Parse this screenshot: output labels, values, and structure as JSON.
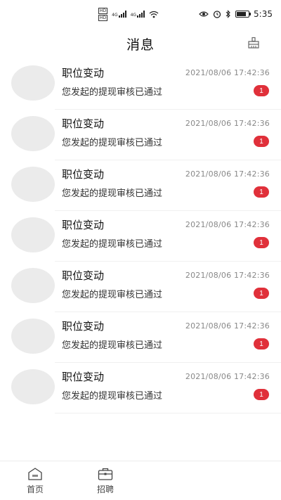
{
  "status_bar": {
    "sim1": "HD",
    "sim2": "HD",
    "net1": "4G",
    "net2": "4G",
    "time": "5:35",
    "icons": [
      "eye-icon",
      "alarm-icon",
      "bluetooth-icon",
      "battery-icon"
    ],
    "battery_level": 0.8
  },
  "header": {
    "title": "消息",
    "action_icon": "broom-icon"
  },
  "messages": [
    {
      "title": "职位变动",
      "time": "2021/08/06 17:42:36",
      "text": "您发起的提现审核已通过",
      "badge": "1"
    },
    {
      "title": "职位变动",
      "time": "2021/08/06 17:42:36",
      "text": "您发起的提现审核已通过",
      "badge": "1"
    },
    {
      "title": "职位变动",
      "time": "2021/08/06 17:42:36",
      "text": "您发起的提现审核已通过",
      "badge": "1"
    },
    {
      "title": "职位变动",
      "time": "2021/08/06 17:42:36",
      "text": "您发起的提现审核已通过",
      "badge": "1"
    },
    {
      "title": "职位变动",
      "time": "2021/08/06 17:42:36",
      "text": "您发起的提现审核已通过",
      "badge": "1"
    },
    {
      "title": "职位变动",
      "time": "2021/08/06 17:42:36",
      "text": "您发起的提现审核已通过",
      "badge": "1"
    },
    {
      "title": "职位变动",
      "time": "2021/08/06 17:42:36",
      "text": "您发起的提现审核已通过",
      "badge": "1"
    }
  ],
  "tabs": [
    {
      "label": "首页",
      "icon": "home-icon"
    },
    {
      "label": "招聘",
      "icon": "briefcase-icon"
    }
  ],
  "colors": {
    "badge": "#e0303a",
    "avatar_placeholder": "#ebebeb"
  }
}
